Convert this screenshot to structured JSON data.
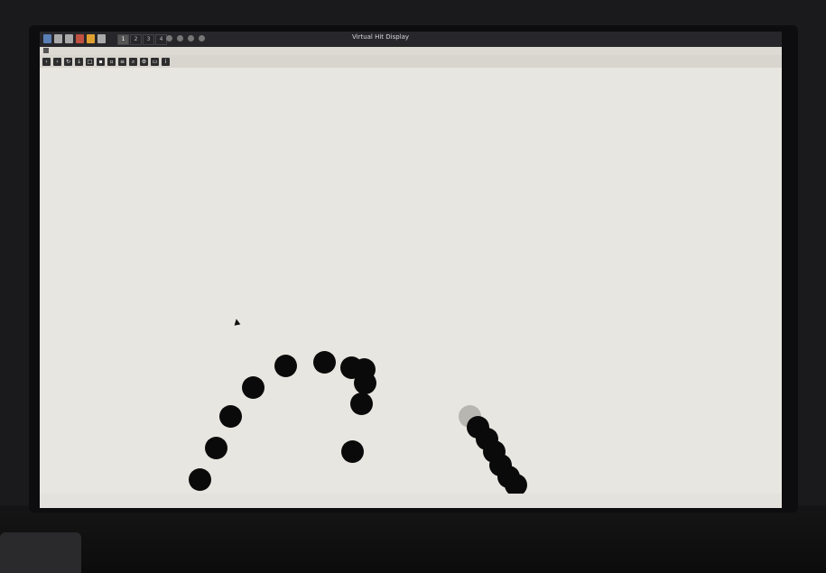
{
  "window": {
    "title": "Virtual Hit Display"
  },
  "taskbar": {
    "workspaces": [
      "1",
      "2",
      "3",
      "4"
    ]
  },
  "toolbar": {
    "buttons": [
      {
        "icon": "back-icon"
      },
      {
        "icon": "forward-icon"
      },
      {
        "icon": "reload-icon"
      },
      {
        "icon": "download-icon"
      },
      {
        "icon": "copy-icon"
      },
      {
        "icon": "save-icon"
      },
      {
        "icon": "open-icon"
      },
      {
        "icon": "print-icon"
      },
      {
        "icon": "zoom-icon"
      },
      {
        "icon": "settings-icon"
      },
      {
        "icon": "window-icon"
      },
      {
        "icon": "info-icon"
      }
    ]
  },
  "statusbar": {
    "text": ""
  },
  "colors": {
    "canvas_bg": "#e8e6e0",
    "dot": "#0a0a0a",
    "ghost_dot": "#b8b6b1",
    "titlebar": "#27272b"
  }
}
